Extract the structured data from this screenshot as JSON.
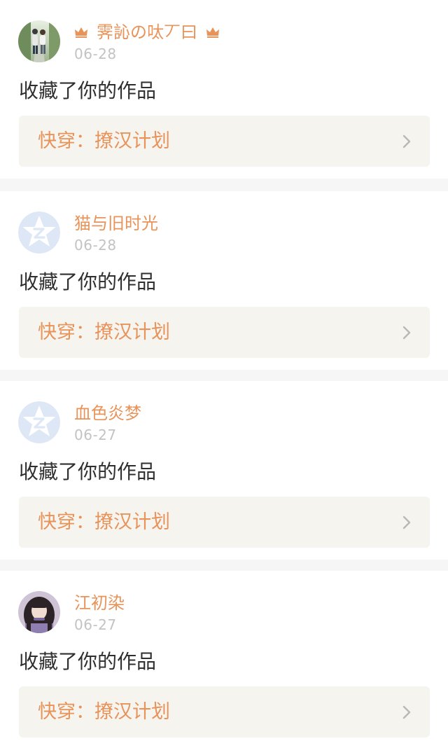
{
  "colors": {
    "accent": "#e8935a",
    "date_text": "#c3c3c3",
    "body_text": "#2f2f2f",
    "work_box_bg": "#f5f4ee",
    "separator": "#f6f6f6",
    "default_avatar_bg": "#dde7f5"
  },
  "notifications": [
    {
      "username": "霁訫の呔丆曰",
      "crown_icons": "crown-icon",
      "date": "06-28",
      "action": "收藏了你的作品",
      "work_title": "快穿：撩汉计划",
      "avatar_icon": "photo-avatar-two-people"
    },
    {
      "username": "猫与旧时光",
      "date": "06-28",
      "action": "收藏了你的作品",
      "work_title": "快穿：撩汉计划",
      "avatar_icon": "default-star-avatar"
    },
    {
      "username": "血色炎梦",
      "date": "06-27",
      "action": "收藏了你的作品",
      "work_title": "快穿：撩汉计划",
      "avatar_icon": "default-star-avatar"
    },
    {
      "username": "江初染",
      "date": "06-27",
      "action": "收藏了你的作品",
      "work_title": "快穿：撩汉计划",
      "avatar_icon": "photo-avatar-girl"
    }
  ]
}
